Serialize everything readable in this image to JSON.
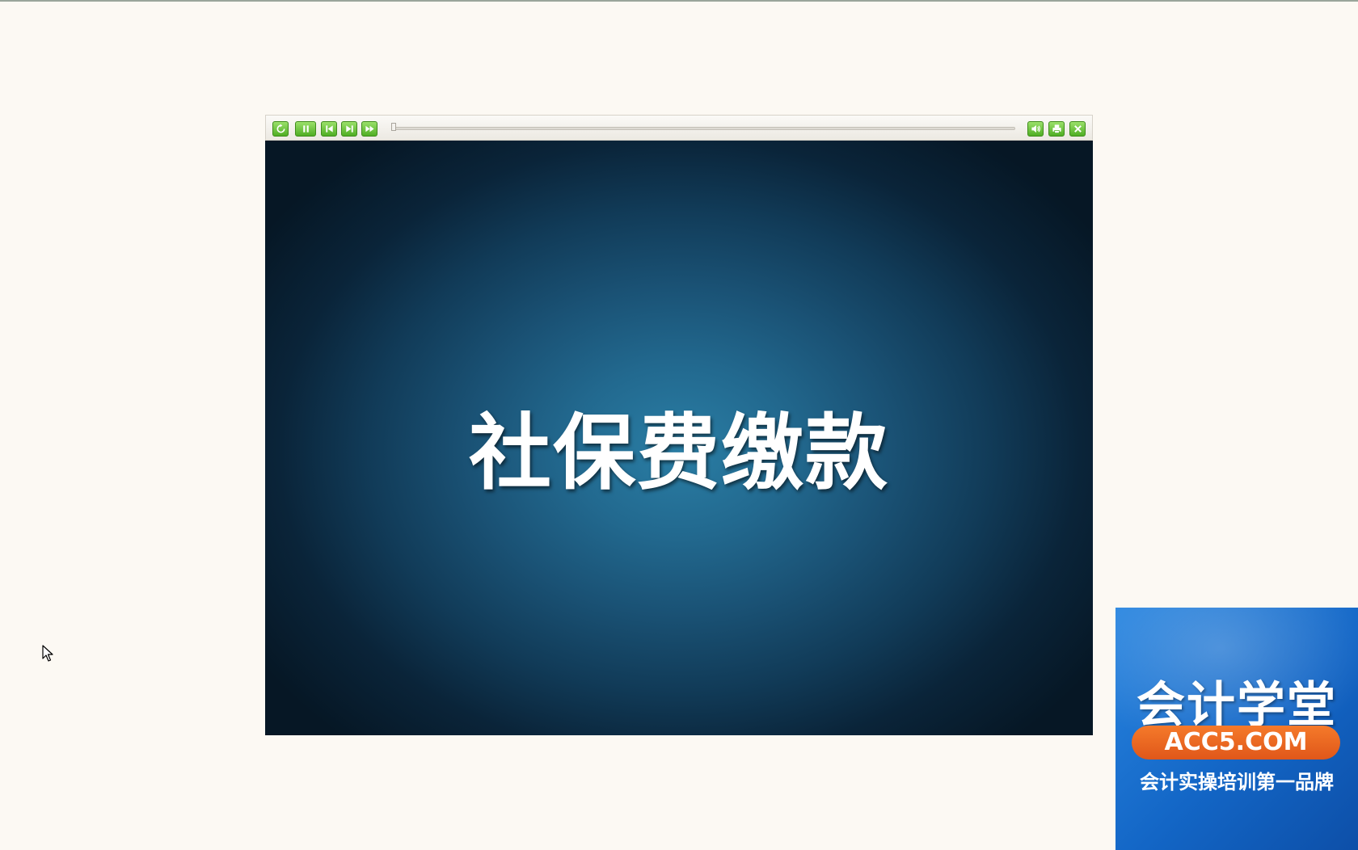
{
  "player": {
    "toolbar": {
      "left_buttons": [
        "replay-icon",
        "pause-icon",
        "previous-icon",
        "next-icon",
        "fast-forward-icon"
      ],
      "right_buttons": [
        "volume-icon",
        "print-icon",
        "close-icon"
      ],
      "button_color": "#5cbf2a"
    },
    "slide": {
      "title": "社保费缴款"
    }
  },
  "brand": {
    "name": "会计学堂",
    "url": "ACC5.COM",
    "tagline": "会计实操培训第一品牌"
  }
}
